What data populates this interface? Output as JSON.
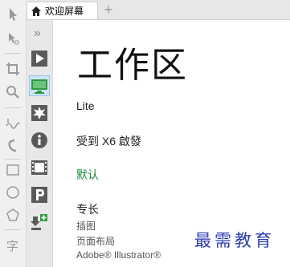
{
  "tab": {
    "title": "欢迎屏幕",
    "add_symbol": "+"
  },
  "sidebar": {
    "collapse_symbol": "»"
  },
  "content": {
    "heading": "工作区",
    "edition": "Lite",
    "received": "受到 X6 啟發",
    "default_link": "默认",
    "specialty": {
      "title": "专长",
      "items": [
        "插图",
        "页面布局",
        "Adobe® Illustrator®"
      ]
    }
  },
  "watermark": "最需教育",
  "colors": {
    "accent_green": "#1a8a3a",
    "selected_bg": "#cfe3f6",
    "watermark": "#2c3fb0"
  },
  "icons": {
    "tools": [
      "pick-tool-icon",
      "shape-edit-icon",
      "crop-icon",
      "zoom-icon",
      "freehand-icon",
      "artistic-media-icon",
      "rectangle-icon",
      "ellipse-icon",
      "polygon-icon",
      "text-icon"
    ],
    "welcome": [
      "play-icon",
      "workspace-monitor-icon",
      "starburst-icon",
      "info-icon",
      "film-icon",
      "p-icon",
      "download-plus-icon"
    ]
  }
}
